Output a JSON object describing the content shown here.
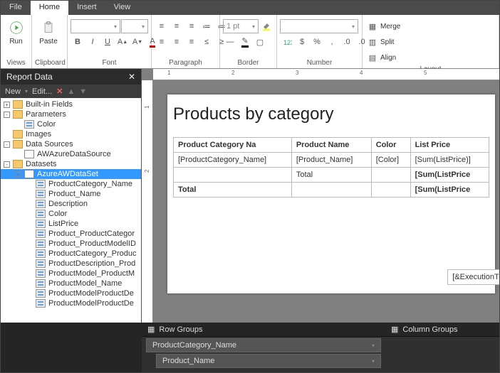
{
  "tabs": {
    "file": "File",
    "home": "Home",
    "insert": "Insert",
    "view": "View"
  },
  "ribbon": {
    "run": "Run",
    "paste": "Paste",
    "groups": {
      "views": "Views",
      "clipboard": "Clipboard",
      "font": "Font",
      "paragraph": "Paragraph",
      "border": "Border",
      "number": "Number",
      "layout": "Layout"
    },
    "border_width": "1 pt",
    "layout_btns": {
      "merge": "Merge",
      "split": "Split",
      "align": "Align"
    }
  },
  "panel": {
    "title": "Report Data",
    "new": "New",
    "edit": "Edit...",
    "tree": [
      {
        "lvl": 0,
        "exp": "+",
        "icon": "folder",
        "label": "Built-in Fields"
      },
      {
        "lvl": 0,
        "exp": "-",
        "icon": "folder",
        "label": "Parameters"
      },
      {
        "lvl": 1,
        "exp": "",
        "icon": "field",
        "label": "Color"
      },
      {
        "lvl": 0,
        "exp": "",
        "icon": "folder",
        "label": "Images"
      },
      {
        "lvl": 0,
        "exp": "-",
        "icon": "folder",
        "label": "Data Sources"
      },
      {
        "lvl": 1,
        "exp": "",
        "icon": "ds",
        "label": "AWAzureDataSource"
      },
      {
        "lvl": 0,
        "exp": "-",
        "icon": "folder",
        "label": "Datasets"
      },
      {
        "lvl": 1,
        "exp": "-",
        "icon": "ds",
        "label": "AzureAWDataSet",
        "sel": true
      },
      {
        "lvl": 2,
        "exp": "",
        "icon": "field",
        "label": "ProductCategory_Name"
      },
      {
        "lvl": 2,
        "exp": "",
        "icon": "field",
        "label": "Product_Name"
      },
      {
        "lvl": 2,
        "exp": "",
        "icon": "field",
        "label": "Description"
      },
      {
        "lvl": 2,
        "exp": "",
        "icon": "field",
        "label": "Color"
      },
      {
        "lvl": 2,
        "exp": "",
        "icon": "field",
        "label": "ListPrice"
      },
      {
        "lvl": 2,
        "exp": "",
        "icon": "field",
        "label": "Product_ProductCategor"
      },
      {
        "lvl": 2,
        "exp": "",
        "icon": "field",
        "label": "Product_ProductModelID"
      },
      {
        "lvl": 2,
        "exp": "",
        "icon": "field",
        "label": "ProductCategory_Produc"
      },
      {
        "lvl": 2,
        "exp": "",
        "icon": "field",
        "label": "ProductDescription_Prod"
      },
      {
        "lvl": 2,
        "exp": "",
        "icon": "field",
        "label": "ProductModel_ProductM"
      },
      {
        "lvl": 2,
        "exp": "",
        "icon": "field",
        "label": "ProductModel_Name"
      },
      {
        "lvl": 2,
        "exp": "",
        "icon": "field",
        "label": "ProductModelProductDe"
      },
      {
        "lvl": 2,
        "exp": "",
        "icon": "field",
        "label": "ProductModelProductDe"
      }
    ]
  },
  "report": {
    "title": "Products by category",
    "headers": [
      "Product Category Na",
      "Product Name",
      "Color",
      "List Price"
    ],
    "rows": [
      [
        "[ProductCategory_Name]",
        "[Product_Name]",
        "[Color]",
        "[Sum(ListPrice)]"
      ],
      [
        "",
        "Total",
        "",
        "[Sum(ListPrice"
      ],
      [
        "Total",
        "",
        "",
        "[Sum(ListPrice"
      ]
    ],
    "exec": "[&ExecutionTime"
  },
  "groups": {
    "row_hdr": "Row Groups",
    "col_hdr": "Column Groups",
    "rows": [
      "ProductCategory_Name",
      "Product_Name"
    ]
  },
  "ruler": {
    "h": [
      "1",
      "2",
      "3",
      "4",
      "5"
    ],
    "v": [
      "1",
      "2"
    ]
  }
}
